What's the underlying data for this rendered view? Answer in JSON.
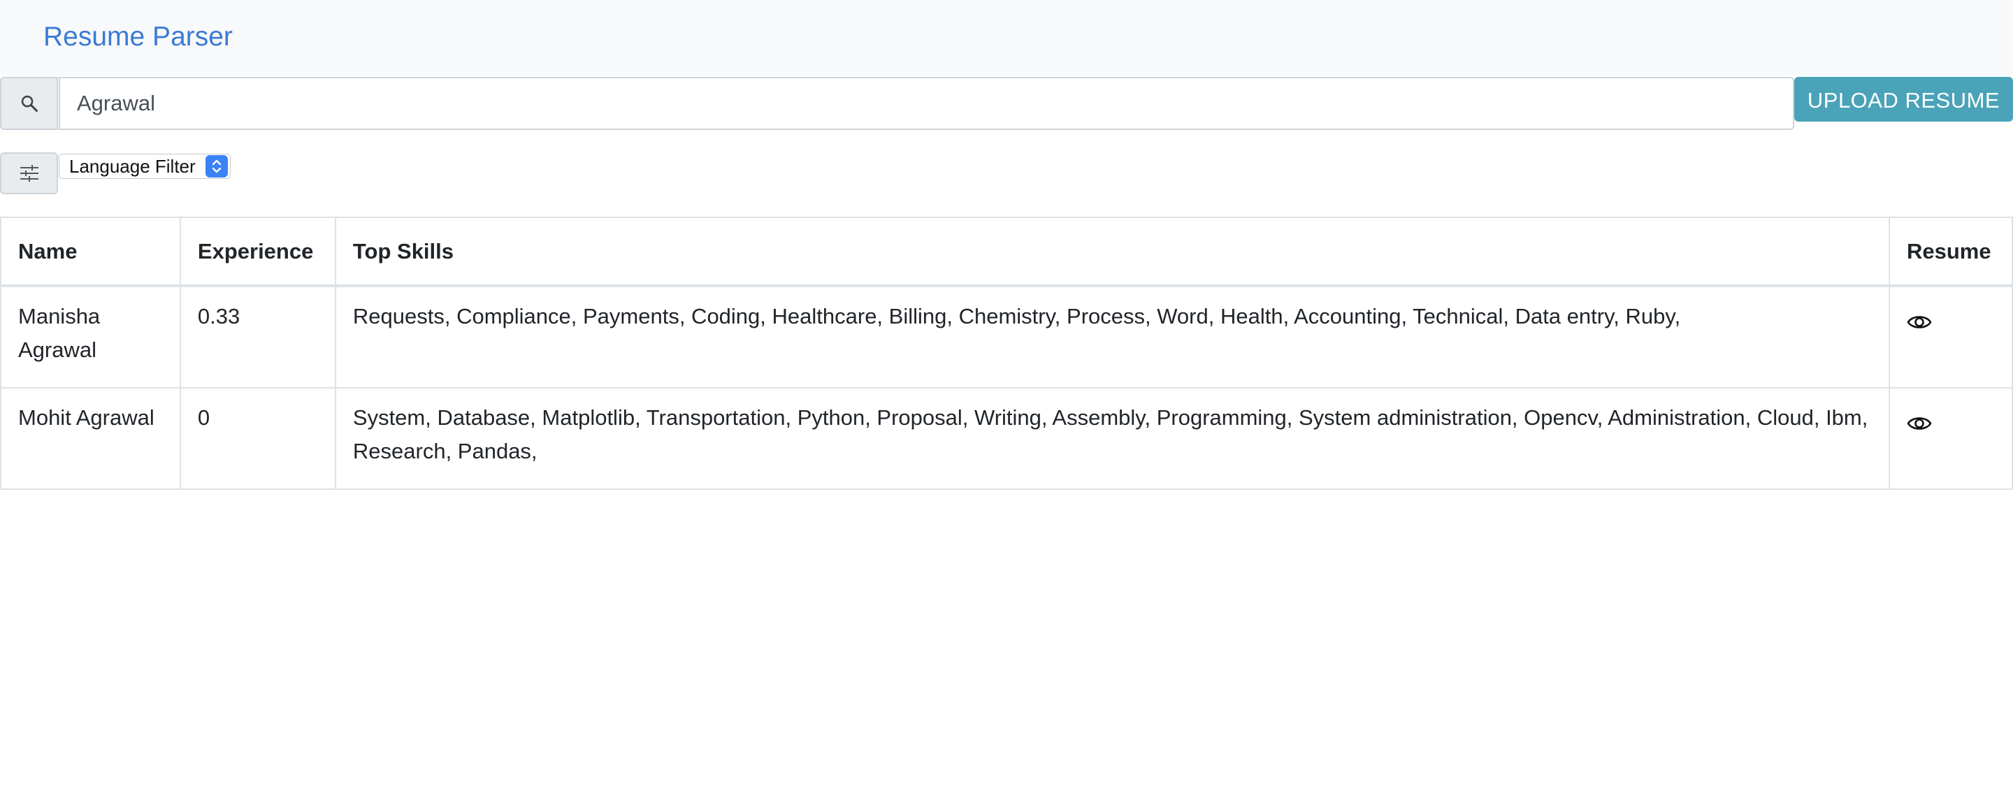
{
  "navbar": {
    "brand": "Resume Parser"
  },
  "search": {
    "value": "Agrawal",
    "icon": "search-icon"
  },
  "upload": {
    "label": "UPLOAD RESUME",
    "color": "#4aa3b8"
  },
  "filter": {
    "icon": "sliders-icon",
    "language_select": "Language Filter"
  },
  "table": {
    "headers": {
      "name": "Name",
      "experience": "Experience",
      "skills": "Top Skills",
      "resume": "Resume"
    },
    "rows": [
      {
        "name": "Manisha Agrawal",
        "experience": "0.33",
        "skills": "Requests, Compliance, Payments, Coding, Healthcare, Billing, Chemistry, Process, Word, Health, Accounting, Technical, Data entry, Ruby,",
        "resume_icon": "eye-icon"
      },
      {
        "name": "Mohit Agrawal",
        "experience": "0",
        "skills": "System, Database, Matplotlib, Transportation, Python, Proposal, Writing, Assembly, Programming, System administration, Opencv, Administration, Cloud, Ibm, Research, Pandas,",
        "resume_icon": "eye-icon"
      }
    ]
  },
  "colors": {
    "brand": "#3a7bd5",
    "navbar_bg": "#f8f9fa",
    "select_accent": "#3b82f6"
  }
}
